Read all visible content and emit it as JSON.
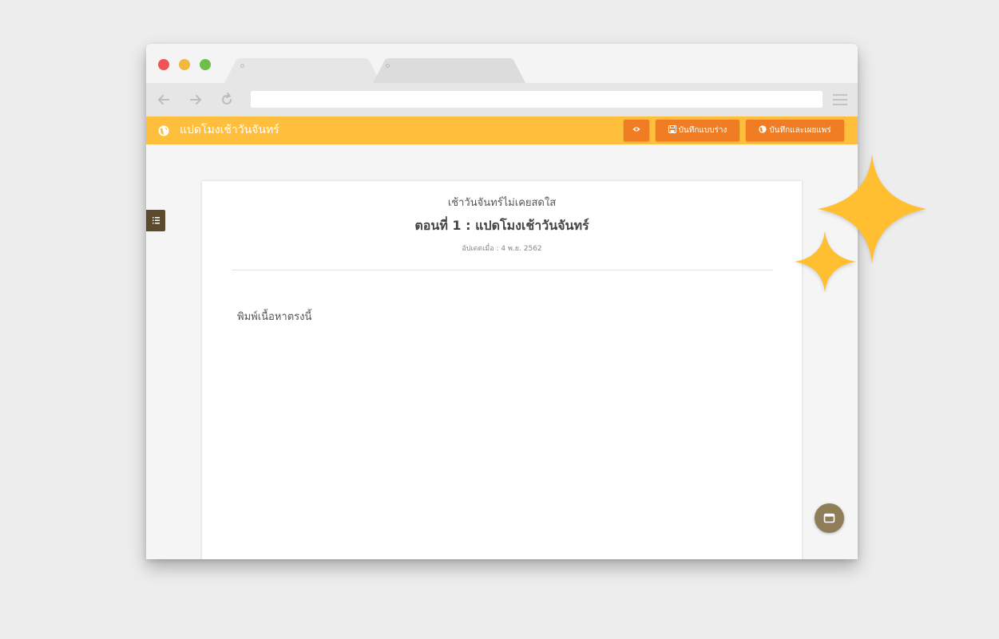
{
  "appbar": {
    "title": "แปดโมงเช้าวันจันทร์",
    "preview_label": "",
    "save_draft_label": "บันทึกแบบร่าง",
    "save_publish_label": "บันทึกและเผยแพร่"
  },
  "document": {
    "story_title": "เช้าวันจันทร์ไม่เคยสดใส",
    "chapter_title": "ตอนที่ 1 : แปดโมงเช้าวันจันทร์",
    "updated": "อัปเดตเมื่อ : 4 พ.ย. 2562",
    "placeholder": "พิมพ์เนื้อหาตรงนี้"
  },
  "icons": {
    "brand": "globe-icon",
    "preview": "eye-icon",
    "draft": "floppy-disk-icon",
    "publish": "globe-icon",
    "sidebar": "list-icon",
    "fab": "window-icon"
  },
  "colors": {
    "appbar": "#ffbf3c",
    "button": "#f07d24",
    "sparkle": "#ffbf30",
    "fab": "#8f7d58"
  }
}
